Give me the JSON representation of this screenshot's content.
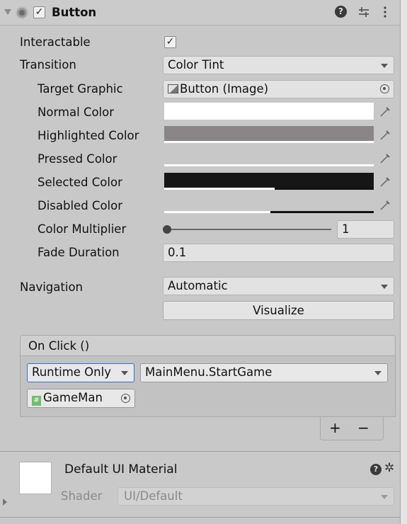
{
  "header": {
    "title": "Button",
    "enabled": true,
    "help_icon": "help-icon",
    "presets_icon": "presets-icon",
    "menu_icon": "kebab-menu-icon"
  },
  "properties": {
    "interactable": {
      "label": "Interactable",
      "checked": true,
      "check_glyph": "✓"
    },
    "transition": {
      "label": "Transition",
      "value": "Color Tint"
    },
    "target_graphic": {
      "label": "Target Graphic",
      "value": "Button (Image)"
    },
    "normal_color": {
      "label": "Normal Color",
      "color": "#ffffff"
    },
    "highlighted_color": {
      "label": "Highlighted Color",
      "color": "#8a8687"
    },
    "pressed_color": {
      "label": "Pressed Color",
      "color": "#c8c8c8"
    },
    "selected_color": {
      "label": "Selected Color",
      "color": "#161616"
    },
    "disabled_color": {
      "label": "Disabled Color",
      "color": "#c8c8c8"
    },
    "color_multiplier": {
      "label": "Color Multiplier",
      "value": "1",
      "slider_fraction": 0.0
    },
    "fade_duration": {
      "label": "Fade Duration",
      "value": "0.1"
    },
    "navigation": {
      "label": "Navigation",
      "value": "Automatic"
    },
    "visualize": {
      "label": "Visualize"
    }
  },
  "on_click": {
    "title": "On Click ()",
    "runtime_mode": "Runtime Only",
    "function": "MainMenu.StartGame",
    "target_object": "GameMan",
    "add_label": "+",
    "remove_label": "−"
  },
  "material": {
    "name": "Default UI Material",
    "shader_label": "Shader",
    "shader_value": "UI/Default"
  }
}
